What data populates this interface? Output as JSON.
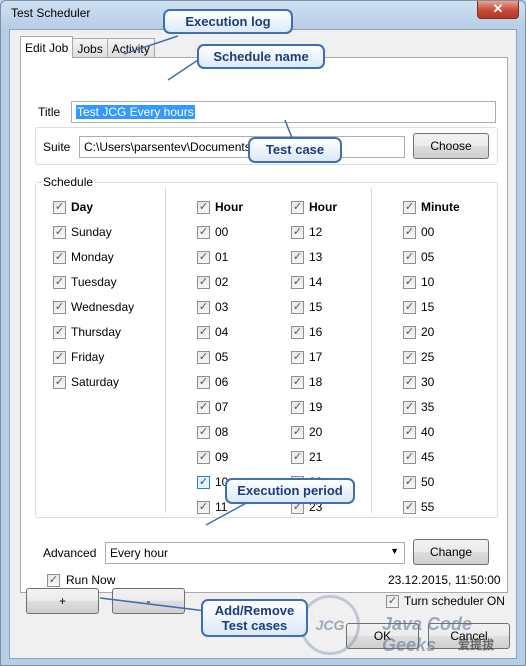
{
  "window": {
    "title": "Test Scheduler",
    "close_glyph": "✕"
  },
  "tabs": [
    "Edit Job",
    "Jobs",
    "Activity"
  ],
  "form": {
    "title_label": "Title",
    "title_value": "Test JCG Every hours",
    "suite_label": "Suite",
    "suite_value": "C:\\Users\\parsentev\\Documents\\Test JCG.html",
    "choose_label": "Choose",
    "schedule_label": "Schedule",
    "advanced_label": "Advanced",
    "advanced_value": "Every hour",
    "change_label": "Change",
    "run_now_label": "Run Now",
    "timestamp": "23.12.2015, 11:50:00"
  },
  "schedule": {
    "day_header": "Day",
    "days": [
      "Sunday",
      "Monday",
      "Tuesday",
      "Wednesday",
      "Thursday",
      "Friday",
      "Saturday"
    ],
    "hour_header_1": "Hour",
    "hours_1": [
      "00",
      "01",
      "02",
      "03",
      "04",
      "05",
      "06",
      "07",
      "08",
      "09",
      "10",
      "11"
    ],
    "hour_header_2": "Hour",
    "hours_2": [
      "12",
      "13",
      "14",
      "15",
      "16",
      "17",
      "18",
      "19",
      "20",
      "21",
      "22",
      "23"
    ],
    "minute_header": "Minute",
    "minutes": [
      "00",
      "05",
      "10",
      "15",
      "20",
      "25",
      "30",
      "35",
      "40",
      "45",
      "50",
      "55"
    ]
  },
  "bottom": {
    "add_label": "+",
    "remove_label": "-",
    "turn_on_label": "Turn scheduler ON",
    "ok_label": "OK",
    "cancel_label": "Cancel"
  },
  "callouts": {
    "execution_log": "Execution log",
    "schedule_name": "Schedule name",
    "test_case": "Test case",
    "execution_period": "Execution period",
    "add_remove_1": "Add/Remove",
    "add_remove_2": "Test cases"
  },
  "watermark": {
    "text": "Java Code Geeks",
    "wechat": "爱提拔"
  },
  "colors": {
    "callout_border": "#3f6fb0",
    "callout_text": "#1a3d7c",
    "selection": "#3399ff"
  }
}
